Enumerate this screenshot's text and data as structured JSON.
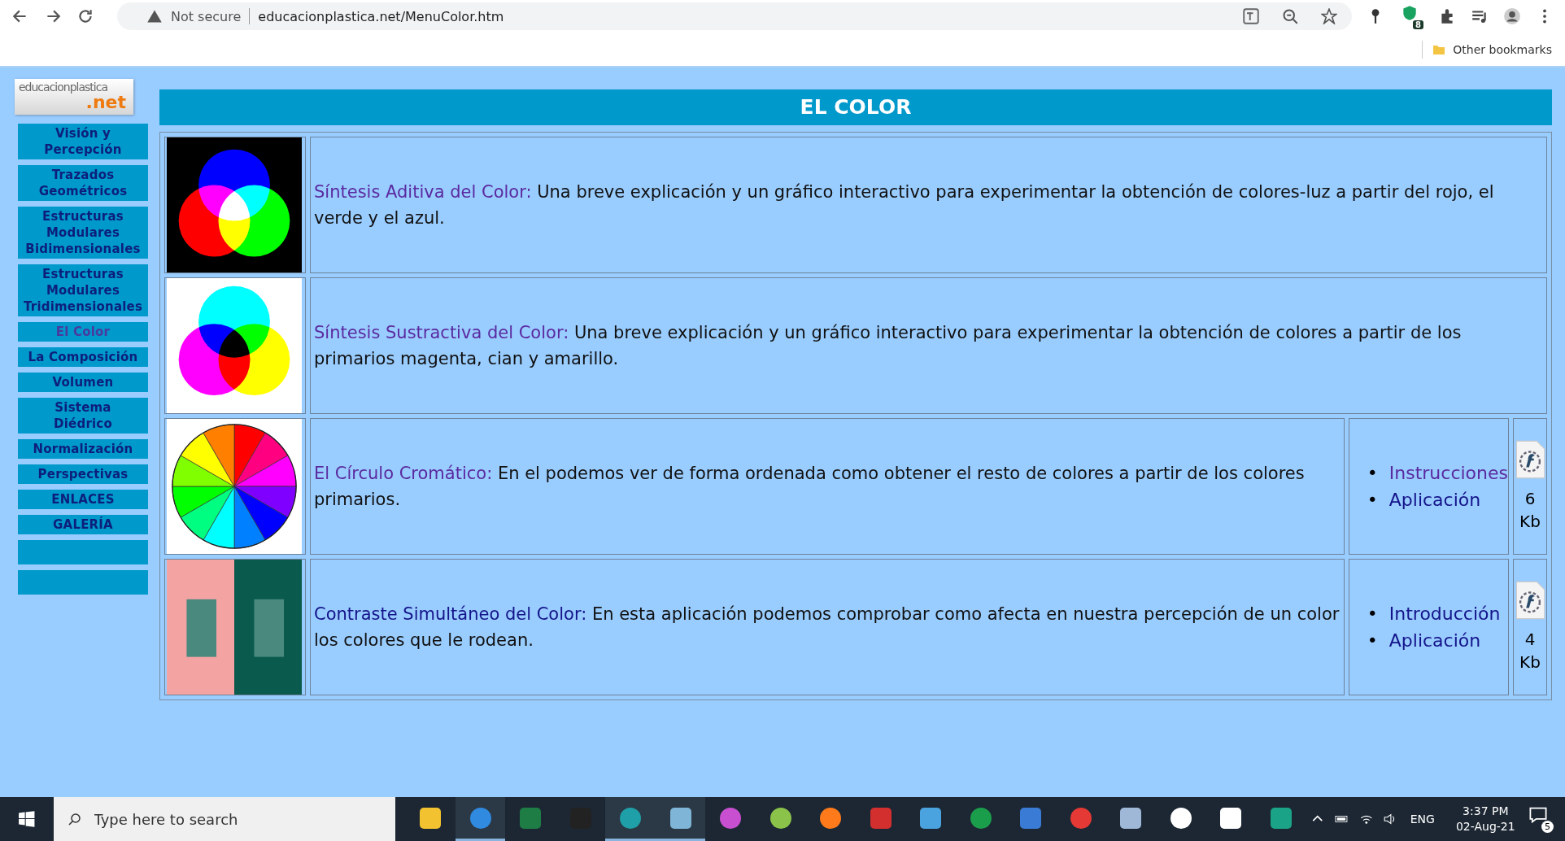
{
  "browser": {
    "security_label": "Not secure",
    "url": "educacionplastica.net/MenuColor.htm",
    "extension_badge": "8",
    "bookmarks": [
      "Other bookmarks"
    ]
  },
  "sidebar": {
    "logo": {
      "top": "educacionplastica",
      "bottom": ".net"
    },
    "items": [
      {
        "label": "Visión y Percepción",
        "selected": false
      },
      {
        "label": "Trazados Geométricos",
        "selected": false
      },
      {
        "label": "Estructuras Modulares Bidimensionales",
        "selected": false
      },
      {
        "label": "Estructuras Modulares Tridimensionales",
        "selected": false
      },
      {
        "label": "El Color",
        "selected": true
      },
      {
        "label": "La Composición",
        "selected": false
      },
      {
        "label": "Volumen",
        "selected": false
      },
      {
        "label": "Sistema Diédrico",
        "selected": false
      },
      {
        "label": "Normalización",
        "selected": false
      },
      {
        "label": "Perspectivas",
        "selected": false
      },
      {
        "label": "ENLACES",
        "selected": false
      },
      {
        "label": "GALERÍA",
        "selected": false
      }
    ]
  },
  "header": "EL COLOR",
  "entries": [
    {
      "kind": "additive",
      "title": "Síntesis Aditiva del Color:",
      "visited": true,
      "description": "Una breve explicación y un gráfico interactivo para experimentar la obtención de colores-luz a partir del rojo, el verde y el azul."
    },
    {
      "kind": "subtractive",
      "title": "Síntesis Sustractiva del Color:",
      "visited": true,
      "description": "Una breve explicación y un gráfico interactivo para experimentar la obtención de colores a partir de los primarios magenta, cian y amarillo."
    },
    {
      "kind": "wheel",
      "title": "El Círculo Cromático:",
      "visited": true,
      "description": "En el podemos ver de forma ordenada como obtener el resto de colores a partir de los colores primarios.",
      "links": [
        {
          "marker": "•",
          "label": "Instrucciones",
          "visited": true
        },
        {
          "marker": "•",
          "label": "Aplicación",
          "visited": false
        }
      ],
      "size": "6 Kb"
    },
    {
      "kind": "contrast",
      "title": "Contraste Simultáneo del Color:",
      "visited": false,
      "description": "En esta aplicación podemos comprobar como afecta en nuestra percepción de un color los colores que le rodean.",
      "links": [
        {
          "marker": "•",
          "label": "Introducción",
          "visited": false
        },
        {
          "marker": "•",
          "label": "Aplicación",
          "visited": false
        }
      ],
      "size": "4 Kb"
    }
  ],
  "taskbar": {
    "search_placeholder": "Type here to search",
    "apps": [
      {
        "kind": "folder",
        "running": false
      },
      {
        "kind": "globe",
        "running": true
      },
      {
        "kind": "spreadsheet",
        "running": false
      },
      {
        "kind": "terminal",
        "running": false
      },
      {
        "kind": "wave",
        "running": true
      },
      {
        "kind": "notepad",
        "running": true
      },
      {
        "kind": "drop",
        "running": false
      },
      {
        "kind": "circle",
        "running": false
      },
      {
        "kind": "fox",
        "running": false
      },
      {
        "kind": "shapes",
        "running": false
      },
      {
        "kind": "card",
        "running": false
      },
      {
        "kind": "tree",
        "running": false
      },
      {
        "kind": "picture",
        "running": false
      },
      {
        "kind": "disc",
        "running": false
      },
      {
        "kind": "palette",
        "running": false
      },
      {
        "kind": "gear",
        "running": false
      },
      {
        "kind": "film",
        "running": false
      },
      {
        "kind": "shield",
        "running": false
      }
    ],
    "language": "ENG",
    "time": "3:37 PM",
    "date": "02-Aug-21",
    "notifications": "5"
  }
}
